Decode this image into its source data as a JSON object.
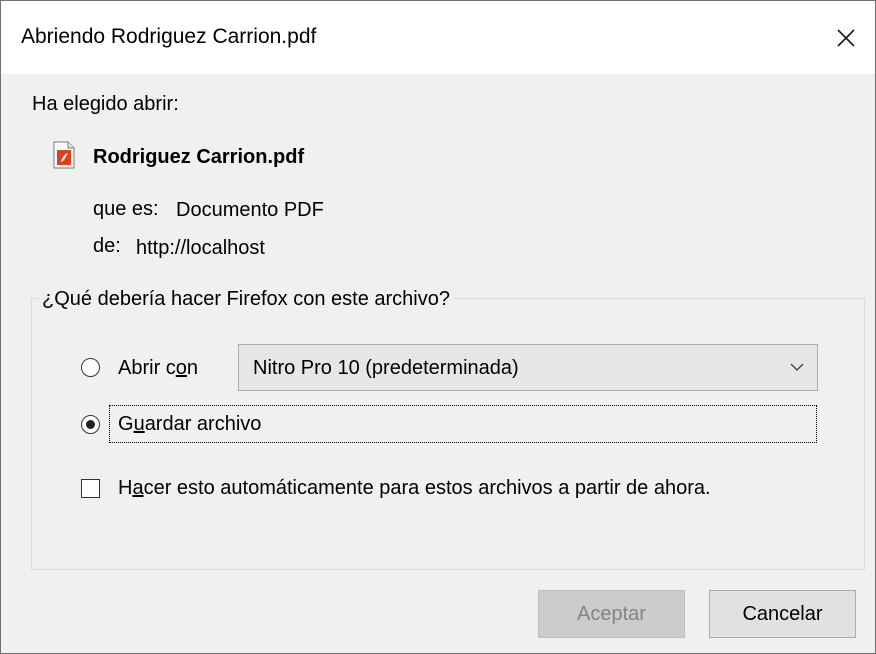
{
  "dialog": {
    "title": "Abriendo Rodriguez Carrion.pdf",
    "close_icon": "close-icon"
  },
  "info": {
    "heading": "Ha elegido abrir:",
    "file_icon": "pdf-file-icon",
    "file_name": "Rodriguez Carrion.pdf",
    "type_label": "que es:",
    "type_value": "Documento PDF",
    "from_label": "de:",
    "from_value": "http://localhost"
  },
  "action_group": {
    "legend": "¿Qué debería hacer Firefox con este archivo?",
    "open_with": {
      "label_pre": "Abrir c",
      "label_accel": "o",
      "label_post": "n",
      "selected": false
    },
    "app_select": {
      "value": "Nitro Pro 10 (predeterminada)",
      "icon": "chevron-down-icon"
    },
    "save_file": {
      "label_pre": "G",
      "label_accel": "u",
      "label_post": "ardar archivo",
      "selected": true
    },
    "auto": {
      "label_pre": "H",
      "label_accel": "a",
      "label_post": "cer esto automáticamente para estos archivos a partir de ahora.",
      "checked": false
    }
  },
  "buttons": {
    "accept": "Aceptar",
    "cancel": "Cancelar"
  },
  "colors": {
    "dialog_bg": "#f0f0f0",
    "titlebar_bg": "#ffffff",
    "pdf_icon": "#e2401c"
  }
}
